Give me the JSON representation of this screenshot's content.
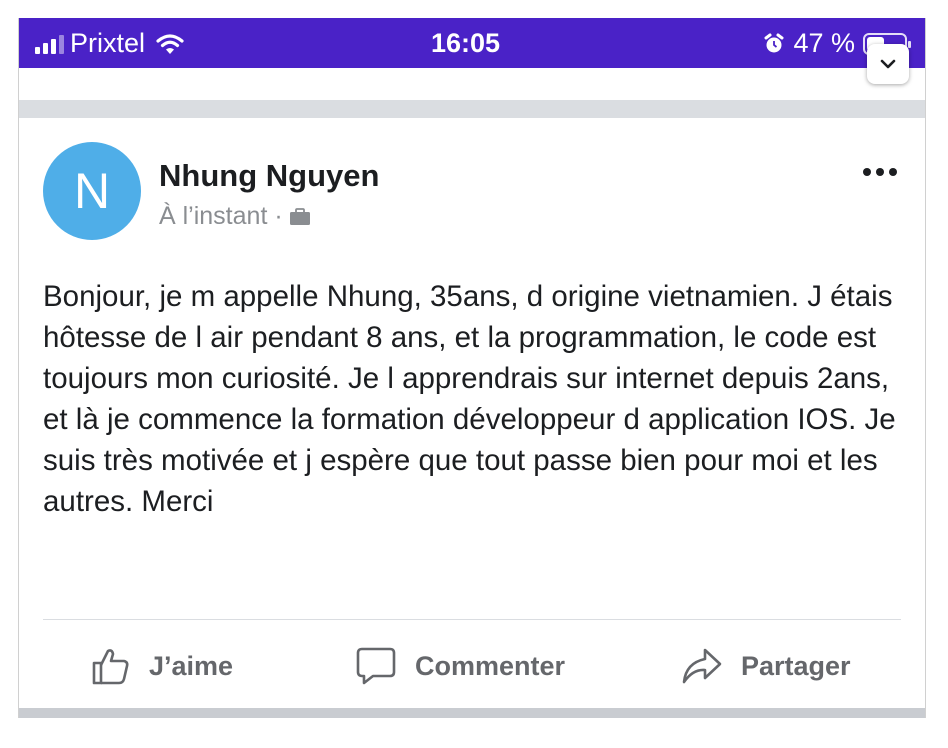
{
  "status_bar": {
    "carrier": "Prixtel",
    "time": "16:05",
    "battery_text": "47 %",
    "battery_level": 0.47,
    "icons": [
      "signal-bars-icon",
      "wifi-icon",
      "alarm-icon",
      "battery-icon"
    ],
    "background_color": "#4a22c7"
  },
  "post": {
    "avatar_letter": "N",
    "avatar_color": "#4faee8",
    "author": "Nhung Nguyen",
    "timestamp": "À l’instant ·",
    "audience_icon": "briefcase-icon",
    "text": "Bonjour, je m appelle Nhung, 35ans, d origine vietnamien. J étais hôtesse de l air pendant 8 ans, et la programmation, le code est toujours mon curiosité. Je l apprendrais sur internet depuis 2ans, et là je commence la formation développeur d application IOS. Je suis très motivée et j espère que tout passe bien pour moi et les autres. Merci",
    "actions": [
      {
        "label": "J’aime",
        "icon": "thumbs-up-icon"
      },
      {
        "label": "Commenter",
        "icon": "comment-icon"
      },
      {
        "label": "Partager",
        "icon": "share-icon"
      }
    ]
  },
  "colors": {
    "action_text": "#65676b",
    "separator": "#dadde1"
  }
}
